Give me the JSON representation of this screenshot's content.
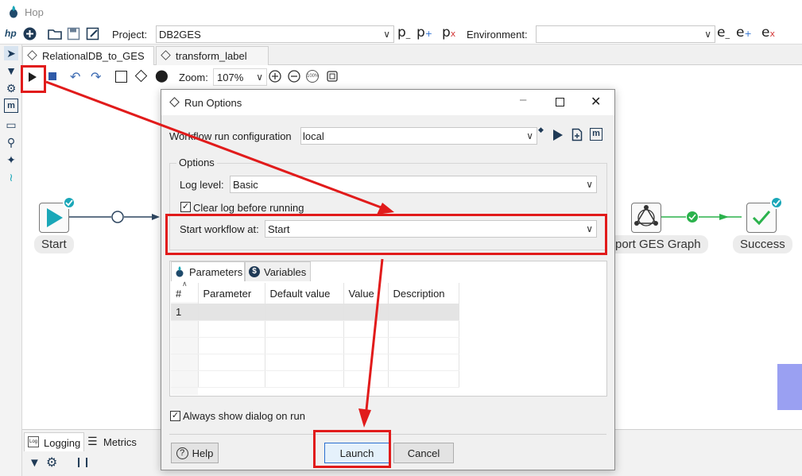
{
  "window": {
    "title": "Hop"
  },
  "toolbar": {
    "project_label": "Project:",
    "project_value": "DB2GES",
    "environment_label": "Environment:",
    "environment_value": "",
    "project_buttons": [
      "p",
      "p",
      "p"
    ],
    "environment_buttons": [
      "e",
      "e",
      "e"
    ]
  },
  "tabs": [
    {
      "label": "RelationalDB_to_GES",
      "active": true
    },
    {
      "label": "transform_label",
      "active": false
    }
  ],
  "canvas_toolbar": {
    "zoom_label": "Zoom:",
    "zoom_value": "107%",
    "zoom_100": "100%"
  },
  "canvas": {
    "nodes": [
      {
        "label": "Start"
      },
      {
        "label": "port GES Graph"
      },
      {
        "label": "Success"
      }
    ]
  },
  "bottom_panel": {
    "tabs": [
      {
        "label": "Logging"
      },
      {
        "label": "Metrics"
      }
    ]
  },
  "dialog": {
    "title": "Run Options",
    "run_config_label": "Workflow run configuration",
    "run_config_value": "local",
    "options_group_label": "Options",
    "log_level_label": "Log level:",
    "log_level_value": "Basic",
    "clear_log_label": "Clear log before running",
    "clear_log_checked": true,
    "start_at_label": "Start workflow at:",
    "start_at_value": "Start",
    "tabs": [
      {
        "label": "Parameters"
      },
      {
        "label": "Variables"
      }
    ],
    "table": {
      "columns": [
        "#",
        "Parameter",
        "Default value",
        "Value",
        "Description"
      ],
      "rows": [
        [
          "1",
          "",
          "",
          "",
          ""
        ]
      ]
    },
    "always_show_label": "Always show dialog on run",
    "always_show_checked": true,
    "help_button": "Help",
    "launch_button": "Launch",
    "cancel_button": "Cancel"
  },
  "colors": {
    "annotation_red": "#e11b1b",
    "accent_teal": "#1aa7b8",
    "success_green": "#2bb24c"
  }
}
